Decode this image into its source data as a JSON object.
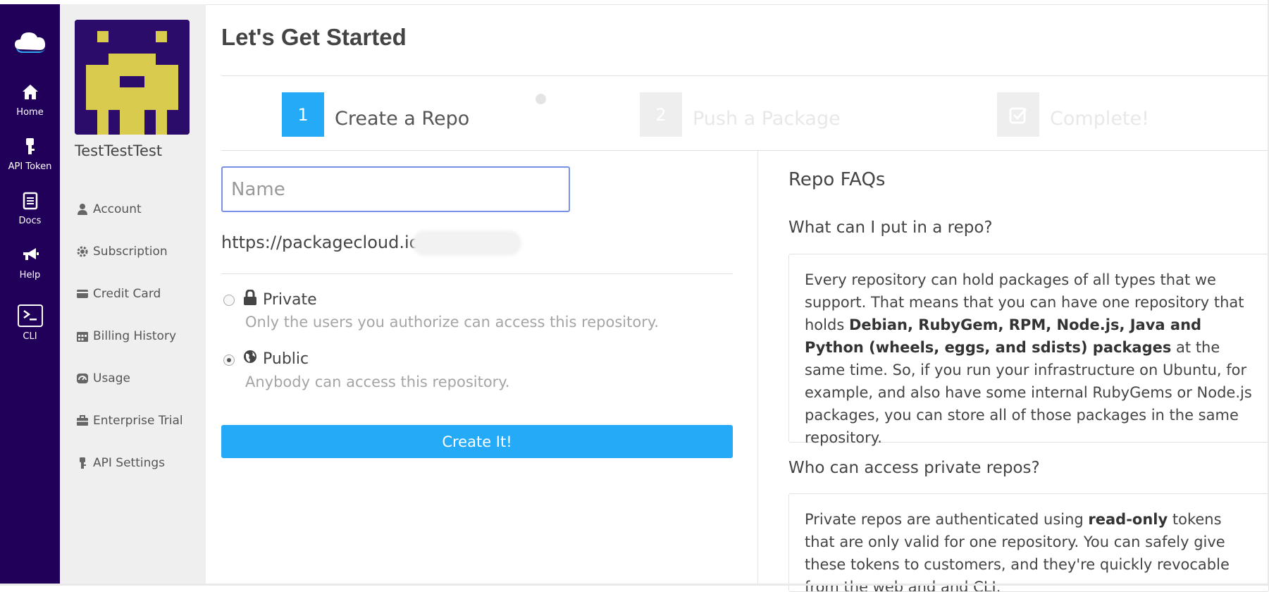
{
  "rail": {
    "items": [
      {
        "label": "Home",
        "icon": "home-icon"
      },
      {
        "label": "API Token",
        "icon": "key-icon"
      },
      {
        "label": "Docs",
        "icon": "docs-icon"
      },
      {
        "label": "Help",
        "icon": "megaphone-icon"
      },
      {
        "label": "CLI",
        "icon": "terminal-icon"
      }
    ]
  },
  "profile": {
    "username": "TestTestTest"
  },
  "subnav": {
    "items": [
      {
        "label": "Account",
        "icon": "user-icon"
      },
      {
        "label": "Subscription",
        "icon": "gear-icon"
      },
      {
        "label": "Credit Card",
        "icon": "credit-card-icon"
      },
      {
        "label": "Billing History",
        "icon": "calendar-icon"
      },
      {
        "label": "Usage",
        "icon": "gauge-icon"
      },
      {
        "label": "Enterprise Trial",
        "icon": "briefcase-icon"
      },
      {
        "label": "API Settings",
        "icon": "key-icon"
      }
    ]
  },
  "page": {
    "title": "Let's Get Started"
  },
  "steps": [
    {
      "number": "1",
      "label": "Create a Repo",
      "active": true
    },
    {
      "number": "2",
      "label": "Push a Package",
      "active": false
    },
    {
      "number": "",
      "label": "Complete!",
      "active": false,
      "icon": "check-square-icon"
    }
  ],
  "form": {
    "name_placeholder": "Name",
    "name_value": "",
    "url_prefix": "https://packagecloud.io/",
    "private": {
      "label": "Private",
      "description": "Only the users you authorize can access this repository.",
      "icon": "lock-icon",
      "checked": false
    },
    "public": {
      "label": "Public",
      "description": "Anybody can access this repository.",
      "icon": "globe-icon",
      "checked": true
    },
    "submit_label": "Create It!"
  },
  "faq": {
    "title": "Repo FAQs",
    "q1": "What can I put in a repo?",
    "a1_part1": "Every repository can hold packages of all types that we support. That means that you can have one repository that holds ",
    "a1_bold": "Debian, RubyGem, RPM, Node.js, Java and Python (wheels, eggs, and sdists) packages",
    "a1_part2": " at the same time. So, if you run your infrastructure on Ubuntu, for example, and also have some internal RubyGems or Node.js packages, you can store all of those packages in the same repository.",
    "q2": "Who can access private repos?",
    "a2_part1": "Private repos are authenticated using ",
    "a2_bold": "read-only",
    "a2_part2": " tokens that are only valid for one repository. You can safely give these tokens to customers, and they're quickly revocable from the web and and CLI."
  },
  "colors": {
    "rail_bg": "#21005a",
    "accent": "#25aaf8",
    "avatar_bg": "#2b0c6b",
    "avatar_fg": "#d9cb4e"
  }
}
